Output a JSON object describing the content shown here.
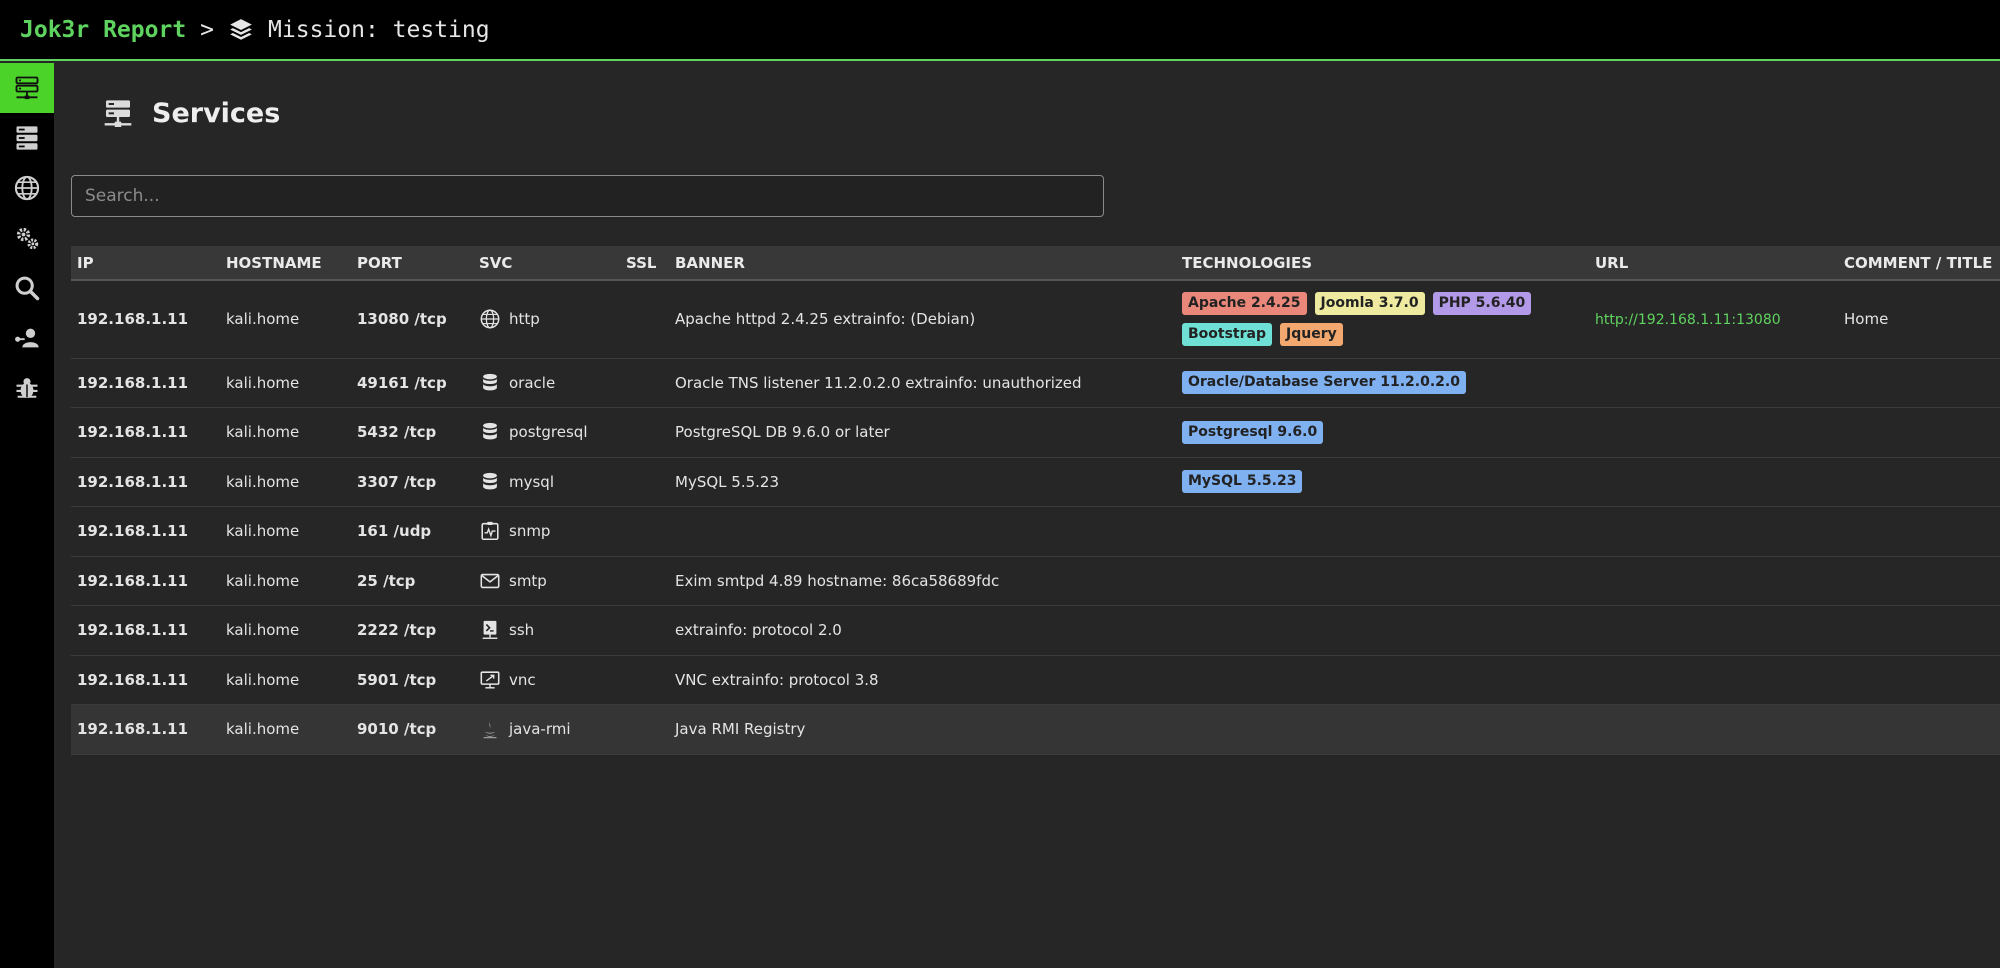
{
  "header": {
    "brand": "Jok3r Report",
    "separator": ">",
    "mission": "Mission: testing"
  },
  "sidebar": {
    "items": [
      {
        "icon": "network-icon",
        "active": true
      },
      {
        "icon": "servers-icon",
        "active": false
      },
      {
        "icon": "globe-icon",
        "active": false
      },
      {
        "icon": "gears-icon",
        "active": false
      },
      {
        "icon": "search-icon",
        "active": false
      },
      {
        "icon": "users-icon",
        "active": false
      },
      {
        "icon": "bug-icon",
        "active": false
      }
    ]
  },
  "page": {
    "title": "Services",
    "search_placeholder": "Search..."
  },
  "table": {
    "columns": [
      "IP",
      "HOSTNAME",
      "PORT",
      "SVC",
      "SSL",
      "BANNER",
      "TECHNOLOGIES",
      "URL",
      "COMMENT / TITLE"
    ],
    "rows": [
      {
        "ip": "192.168.1.11",
        "hostname": "kali.home",
        "port": "13080 /tcp",
        "svc": "http",
        "svc_icon": "globe-icon",
        "ssl": "",
        "banner": "Apache httpd 2.4.25 extrainfo: (Debian)",
        "url": "http://192.168.1.11:13080",
        "comment": "Home"
      },
      {
        "ip": "192.168.1.11",
        "hostname": "kali.home",
        "port": "49161 /tcp",
        "svc": "oracle",
        "svc_icon": "database-icon",
        "ssl": "",
        "banner": "Oracle TNS listener 11.2.0.2.0 extrainfo: unauthorized",
        "url": "",
        "comment": ""
      },
      {
        "ip": "192.168.1.11",
        "hostname": "kali.home",
        "port": "5432 /tcp",
        "svc": "postgresql",
        "svc_icon": "database-icon",
        "ssl": "",
        "banner": "PostgreSQL DB 9.6.0 or later",
        "url": "",
        "comment": ""
      },
      {
        "ip": "192.168.1.11",
        "hostname": "kali.home",
        "port": "3307 /tcp",
        "svc": "mysql",
        "svc_icon": "database-icon",
        "ssl": "",
        "banner": "MySQL 5.5.23",
        "url": "",
        "comment": ""
      },
      {
        "ip": "192.168.1.11",
        "hostname": "kali.home",
        "port": "161 /udp",
        "svc": "snmp",
        "svc_icon": "monitor-heart-icon",
        "ssl": "",
        "banner": "",
        "url": "",
        "comment": ""
      },
      {
        "ip": "192.168.1.11",
        "hostname": "kali.home",
        "port": "25 /tcp",
        "svc": "smtp",
        "svc_icon": "envelope-icon",
        "ssl": "",
        "banner": "Exim smtpd 4.89 hostname: 86ca58689fdc",
        "url": "",
        "comment": ""
      },
      {
        "ip": "192.168.1.11",
        "hostname": "kali.home",
        "port": "2222 /tcp",
        "svc": "ssh",
        "svc_icon": "terminal-icon",
        "ssl": "",
        "banner": "extrainfo: protocol 2.0",
        "url": "",
        "comment": ""
      },
      {
        "ip": "192.168.1.11",
        "hostname": "kali.home",
        "port": "5901 /tcp",
        "svc": "vnc",
        "svc_icon": "remote-desktop-icon",
        "ssl": "",
        "banner": "VNC extrainfo: protocol 3.8",
        "url": "",
        "comment": ""
      },
      {
        "ip": "192.168.1.11",
        "hostname": "kali.home",
        "port": "9010 /tcp",
        "svc": "java-rmi",
        "svc_icon": "java-icon",
        "ssl": "",
        "banner": "Java RMI Registry",
        "url": "",
        "comment": ""
      }
    ],
    "technologies": [
      [
        {
          "label": "Apache 2.4.25",
          "color": "#e8877a"
        },
        {
          "label": "Joomla 3.7.0",
          "color": "#eeeaa0"
        },
        {
          "label": "PHP 5.6.40",
          "color": "#b39ae8"
        },
        {
          "label": "Bootstrap",
          "color": "#6fe0d6"
        },
        {
          "label": "Jquery",
          "color": "#f2a86e"
        }
      ],
      [
        {
          "label": "Oracle/Database Server 11.2.0.2.0",
          "color": "#7fb0f0"
        }
      ],
      [
        {
          "label": "Postgresql 9.6.0",
          "color": "#7fb0f0"
        }
      ],
      [
        {
          "label": "MySQL 5.5.23",
          "color": "#7fb0f0"
        }
      ]
    ]
  },
  "colors": {
    "accent": "#5fd35f",
    "active_sidebar": "#4bd32a",
    "background": "#262626",
    "header_row": "#383838"
  }
}
